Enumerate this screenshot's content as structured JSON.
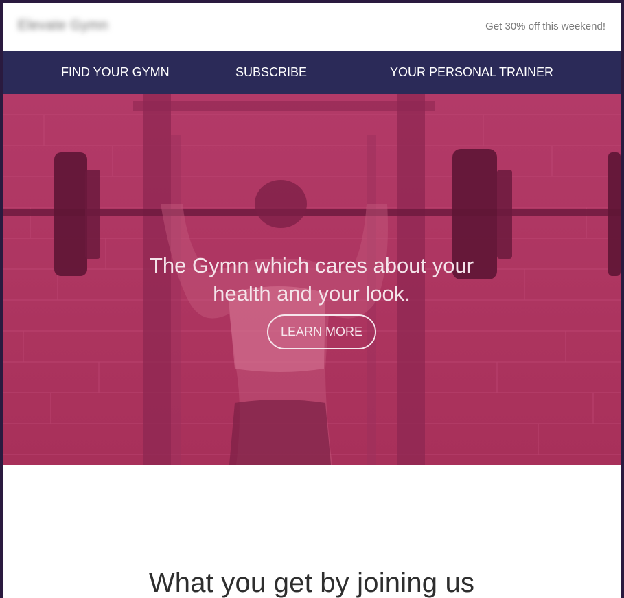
{
  "brand": {
    "logo_text": "Elevate Gymn"
  },
  "promo": {
    "text": "Get 30% off this weekend!"
  },
  "nav": {
    "items": [
      {
        "label": "FIND YOUR GYMN"
      },
      {
        "label": "SUBSCRIBE"
      },
      {
        "label": "YOUR PERSONAL TRAINER"
      }
    ]
  },
  "hero": {
    "title_line1": "The Gymn which cares about your",
    "title_line2": "health and your look.",
    "cta_label": "LEARN MORE"
  },
  "section": {
    "title": "What you get by joining us"
  },
  "colors": {
    "nav_bg": "#2b2a58",
    "hero_overlay": "#b33a68",
    "frame_bg": "#2a1a3f"
  }
}
